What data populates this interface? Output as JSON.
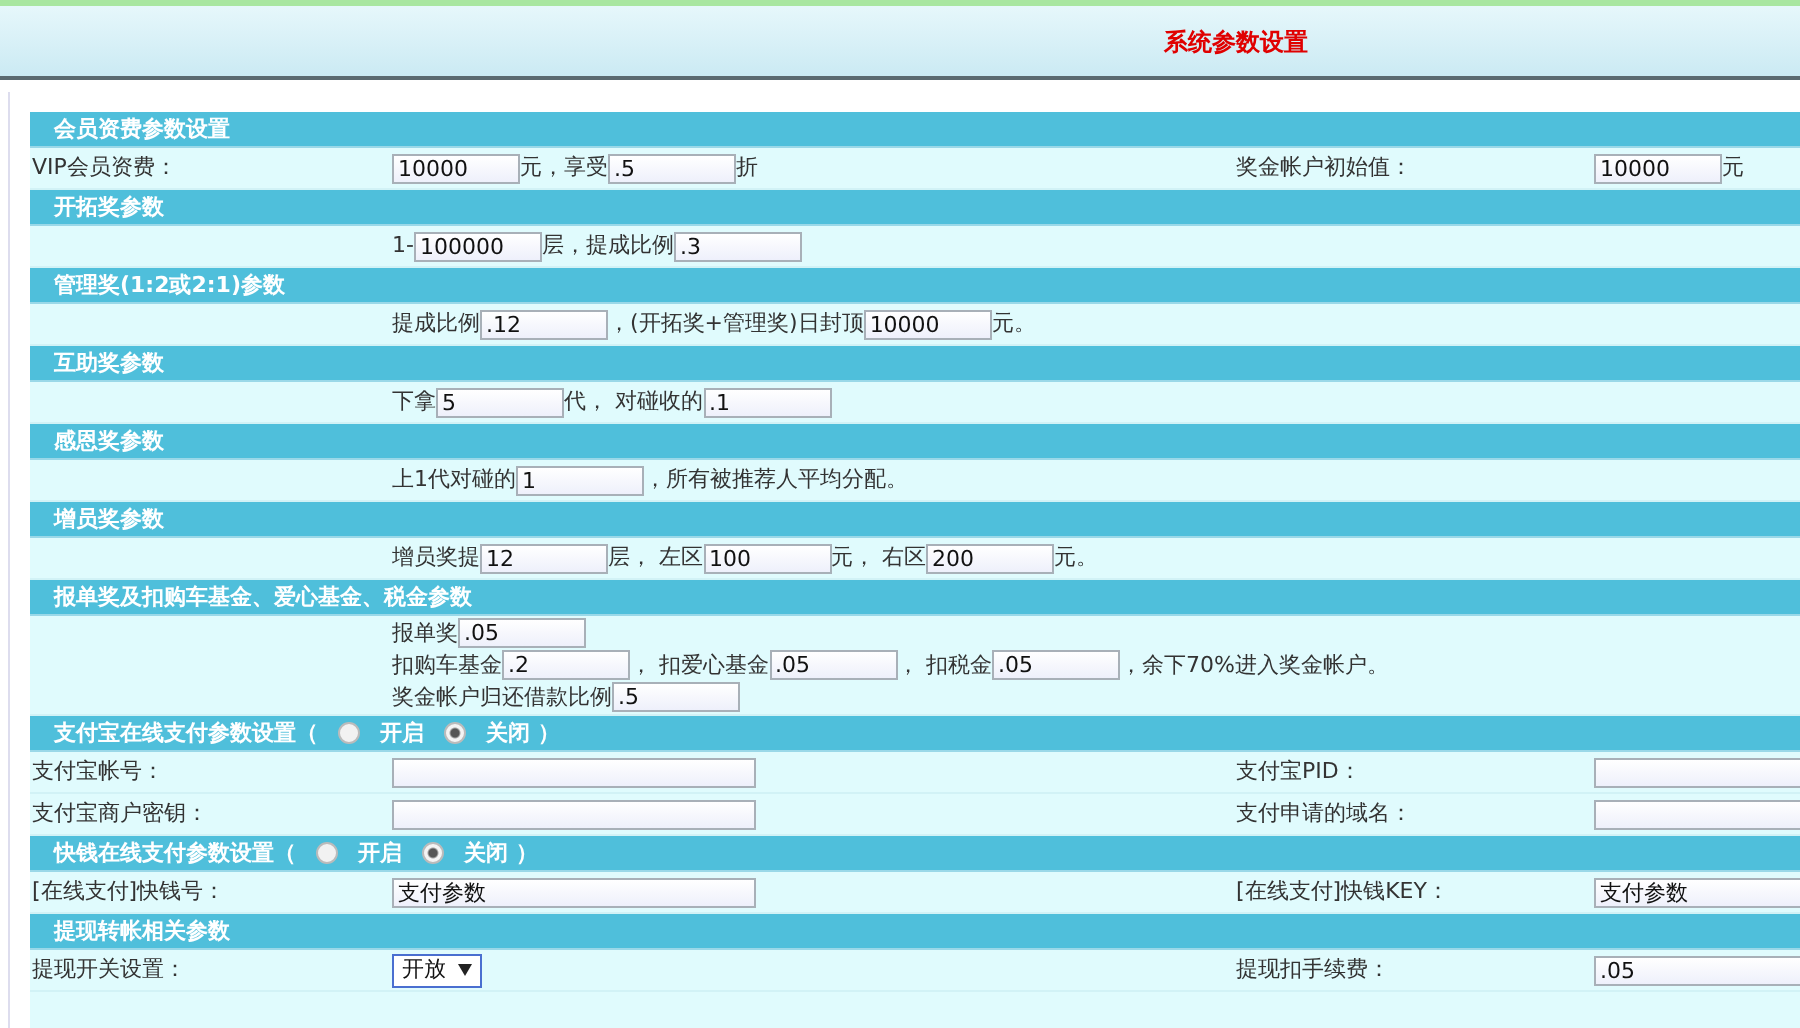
{
  "page_title": "系统参数设置",
  "sections": [
    {
      "title": "会员资费参数设置",
      "rows": [
        {
          "label": "VIP会员资费：",
          "main": [
            [
              {
                "kind": "input",
                "value": "10000"
              },
              {
                "kind": "text",
                "text": "元，享受"
              },
              {
                "kind": "input",
                "value": ".5"
              },
              {
                "kind": "text",
                "text": "折"
              }
            ]
          ],
          "right_label": "奖金帐户初始值：",
          "right": [
            {
              "kind": "input",
              "value": "10000"
            },
            {
              "kind": "text",
              "text": "元"
            }
          ]
        }
      ]
    },
    {
      "title": "开拓奖参数",
      "rows": [
        {
          "main": [
            [
              {
                "kind": "text",
                "text": "1-"
              },
              {
                "kind": "input",
                "value": "100000"
              },
              {
                "kind": "text",
                "text": "层，提成比例"
              },
              {
                "kind": "input",
                "value": ".3"
              }
            ]
          ]
        }
      ]
    },
    {
      "title": "管理奖(1:2或2:1)参数",
      "rows": [
        {
          "main": [
            [
              {
                "kind": "text",
                "text": "提成比例"
              },
              {
                "kind": "input",
                "value": ".12"
              },
              {
                "kind": "text",
                "text": "，(开拓奖+管理奖)日封顶"
              },
              {
                "kind": "input",
                "value": "10000"
              },
              {
                "kind": "text",
                "text": "元。"
              }
            ]
          ]
        }
      ]
    },
    {
      "title": "互助奖参数",
      "rows": [
        {
          "main": [
            [
              {
                "kind": "text",
                "text": "下拿"
              },
              {
                "kind": "input",
                "value": "5"
              },
              {
                "kind": "text",
                "text": "代， 对碰收的"
              },
              {
                "kind": "input",
                "value": ".1"
              }
            ]
          ]
        }
      ]
    },
    {
      "title": "感恩奖参数",
      "rows": [
        {
          "main": [
            [
              {
                "kind": "text",
                "text": "上1代对碰的"
              },
              {
                "kind": "input",
                "value": "1"
              },
              {
                "kind": "text",
                "text": "，所有被推荐人平均分配。"
              }
            ]
          ]
        }
      ]
    },
    {
      "title": "增员奖参数",
      "rows": [
        {
          "main": [
            [
              {
                "kind": "text",
                "text": "增员奖提"
              },
              {
                "kind": "input",
                "value": "12"
              },
              {
                "kind": "text",
                "text": "层， 左区"
              },
              {
                "kind": "input",
                "value": "100"
              },
              {
                "kind": "text",
                "text": "元， 右区"
              },
              {
                "kind": "input",
                "value": "200"
              },
              {
                "kind": "text",
                "text": "元。"
              }
            ]
          ]
        }
      ]
    },
    {
      "title": "报单奖及扣购车基金、爱心基金、税金参数",
      "rows": [
        {
          "main": [
            [
              {
                "kind": "text",
                "text": "报单奖"
              },
              {
                "kind": "input",
                "value": ".05"
              }
            ],
            [
              {
                "kind": "text",
                "text": "扣购车基金"
              },
              {
                "kind": "input",
                "value": ".2"
              },
              {
                "kind": "text",
                "text": "， 扣爱心基金"
              },
              {
                "kind": "input",
                "value": ".05"
              },
              {
                "kind": "text",
                "text": "， 扣税金"
              },
              {
                "kind": "input",
                "value": ".05"
              },
              {
                "kind": "text",
                "text": "，余下70%进入奖金帐户。"
              }
            ],
            [
              {
                "kind": "text",
                "text": "奖金帐户归还借款比例"
              },
              {
                "kind": "input",
                "value": ".5"
              }
            ]
          ]
        }
      ]
    },
    {
      "title": "支付宝在线支付参数设置（",
      "radios": [
        {
          "label": "开启",
          "selected": false
        },
        {
          "label": "关闭",
          "selected": true
        }
      ],
      "title_end": "）",
      "rows": [
        {
          "label": "支付宝帐号：",
          "main": [
            [
              {
                "kind": "wide_input"
              }
            ]
          ],
          "right_label": "支付宝PID：",
          "right": [
            {
              "kind": "wide_input"
            }
          ]
        },
        {
          "label": "支付宝商户密钥：",
          "main": [
            [
              {
                "kind": "wide_input"
              }
            ]
          ],
          "right_label": "支付申请的域名：",
          "right": [
            {
              "kind": "wide_input"
            }
          ]
        }
      ]
    },
    {
      "title": "快钱在线支付参数设置（",
      "radios": [
        {
          "label": "开启",
          "selected": false
        },
        {
          "label": "关闭",
          "selected": true
        }
      ],
      "title_end": "）",
      "rows": [
        {
          "label": "[在线支付]快钱号：",
          "main": [
            [
              {
                "kind": "wide_input",
                "value": "支付参数"
              }
            ]
          ],
          "right_label": "[在线支付]快钱KEY：",
          "right": [
            {
              "kind": "wide_input",
              "value": "支付参数"
            }
          ]
        }
      ]
    },
    {
      "title": "提现转帐相关参数",
      "rows": [
        {
          "label": "提现开关设置：",
          "main": [
            [
              {
                "kind": "select",
                "value": "开放"
              }
            ]
          ],
          "right_label": "提现扣手续费：",
          "right": [
            {
              "kind": "wide_input",
              "value": ".05"
            }
          ]
        }
      ]
    }
  ]
}
